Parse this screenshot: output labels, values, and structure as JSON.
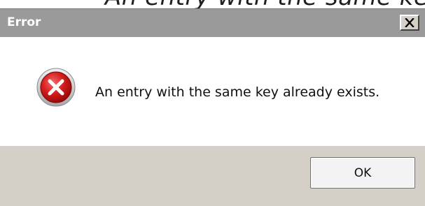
{
  "background": {
    "partial_text": "An entry with the same key already exists."
  },
  "dialog": {
    "title": "Error",
    "close_icon": "close-icon",
    "message_icon": "error-icon",
    "message": "An entry with the same key already exists.",
    "ok_label": "OK"
  },
  "colors": {
    "titlebar": "#9a9a9a",
    "footer": "#d4d0c8",
    "error_red": "#d41c1c"
  }
}
